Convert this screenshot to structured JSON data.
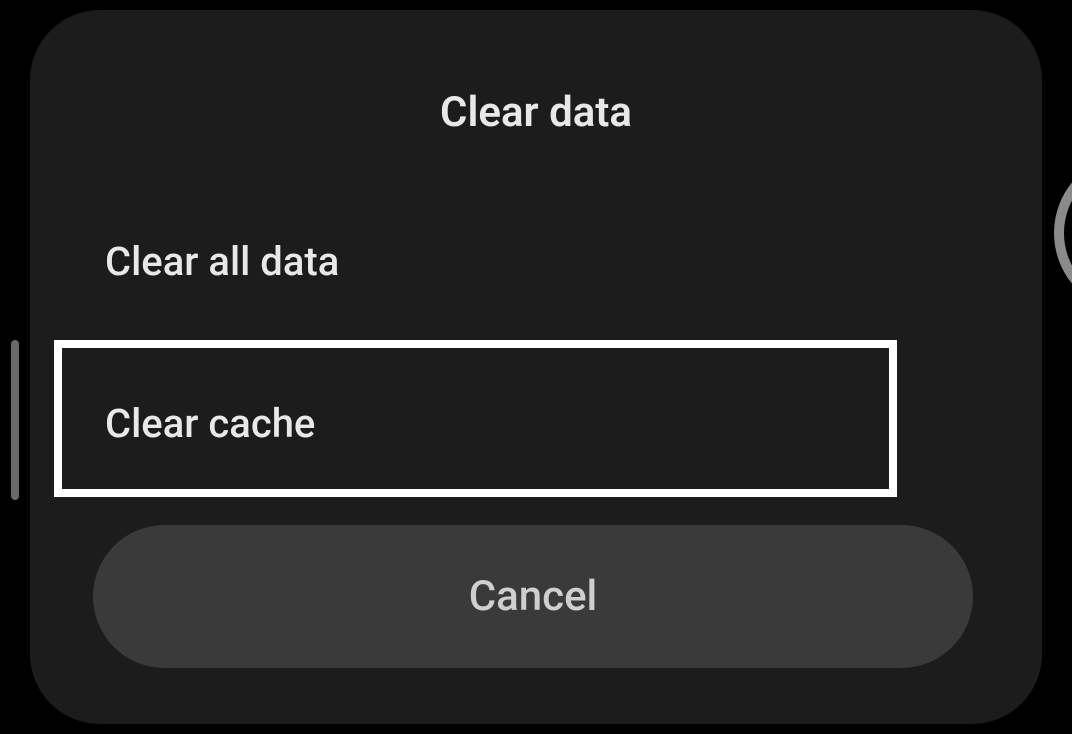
{
  "dialog": {
    "title": "Clear data",
    "options": [
      {
        "label": "Clear all data"
      },
      {
        "label": "Clear cache"
      }
    ],
    "cancel_label": "Cancel"
  }
}
